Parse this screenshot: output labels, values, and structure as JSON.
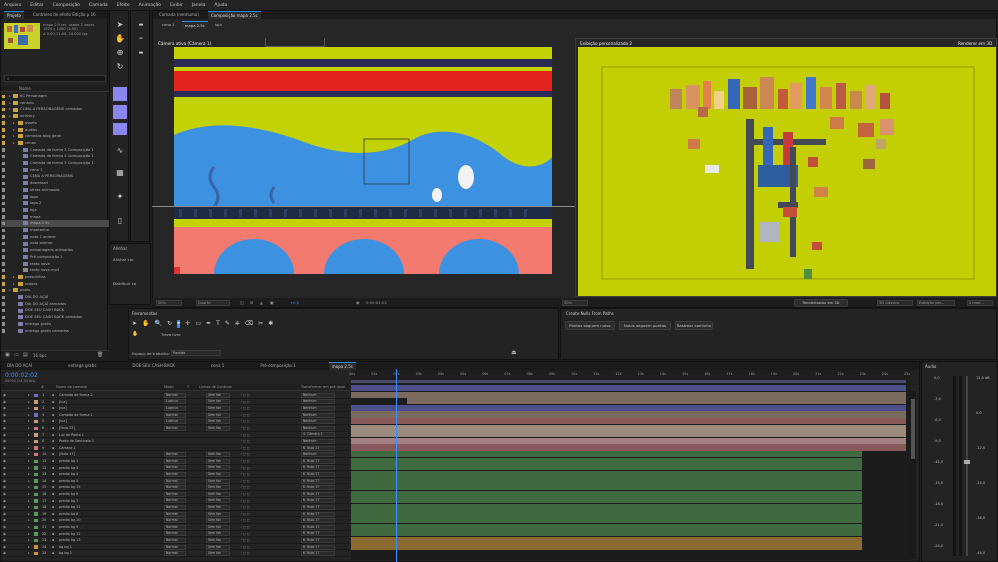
{
  "menu": [
    "Arquivo",
    "Editar",
    "Composição",
    "Camada",
    "Efeito",
    "Animação",
    "Exibir",
    "Janela",
    "Ajuda"
  ],
  "project": {
    "tabs": [
      "Projeto",
      "Controles de efeito Edição p 16"
    ],
    "info": [
      "mapa 2.5.ter, usado 2 vezes",
      "1920 x 1080 (1,00)",
      "Δ 0;00;11;00, 24,000 fps"
    ],
    "column_name": "Nome",
    "rows": [
      {
        "depth": 0,
        "name": "BC Personagm",
        "color": "#c9a43a",
        "icon": "folder"
      },
      {
        "depth": 0,
        "name": "cenario",
        "color": "#c9a43a",
        "icon": "folder"
      },
      {
        "depth": 0,
        "name": "CLIMA A PERSONAGENS camadas",
        "color": "#c9a43a",
        "icon": "folder"
      },
      {
        "depth": 0,
        "name": "delivery",
        "color": "#c9a43a",
        "icon": "folder"
      },
      {
        "depth": 1,
        "name": "assets",
        "color": "#c9a43a",
        "icon": "folder"
      },
      {
        "depth": 1,
        "name": "audios",
        "color": "#c9a43a",
        "icon": "folder"
      },
      {
        "depth": 1,
        "name": "camadas blog geral",
        "color": "#c9a43a",
        "icon": "folder"
      },
      {
        "depth": 1,
        "name": "cenas",
        "color": "#c9a43a",
        "icon": "folder"
      },
      {
        "depth": 2,
        "name": "Camada de forma 3 Composição 1",
        "color": "#8d8d8d",
        "icon": "comp"
      },
      {
        "depth": 2,
        "name": "Camada de forma 4 Composição 1",
        "color": "#8d8d8d",
        "icon": "comp"
      },
      {
        "depth": 2,
        "name": "Camada de forma 5 Composição 1",
        "color": "#8d8d8d",
        "icon": "comp"
      },
      {
        "depth": 2,
        "name": "cena 1",
        "color": "#8d8d8d",
        "icon": "comp"
      },
      {
        "depth": 2,
        "name": "CENA A PERSONAGENS",
        "color": "#8d8d8d",
        "icon": "comp"
      },
      {
        "depth": 2,
        "name": "download",
        "color": "#8d8d8d",
        "icon": "comp"
      },
      {
        "depth": 2,
        "name": "letras animadas",
        "color": "#8d8d8d",
        "icon": "comp"
      },
      {
        "depth": 2,
        "name": "logo",
        "color": "#8d8d8d",
        "icon": "comp"
      },
      {
        "depth": 2,
        "name": "logo 2",
        "color": "#8d8d8d",
        "icon": "comp"
      },
      {
        "depth": 2,
        "name": "loja",
        "color": "#8d8d8d",
        "icon": "comp"
      },
      {
        "depth": 2,
        "name": "mapa",
        "color": "#8d8d8d",
        "icon": "comp"
      },
      {
        "depth": 2,
        "name": "mapa 2.5c",
        "color": "#8d8d8d",
        "icon": "comp",
        "selected": true
      },
      {
        "depth": 2,
        "name": "montanha",
        "color": "#8d8d8d",
        "icon": "comp"
      },
      {
        "depth": 2,
        "name": "nota 1 animar",
        "color": "#8d8d8d",
        "icon": "comp"
      },
      {
        "depth": 2,
        "name": "nota animar",
        "color": "#8d8d8d",
        "icon": "comp"
      },
      {
        "depth": 2,
        "name": "personagens animados",
        "color": "#8d8d8d",
        "icon": "comp"
      },
      {
        "depth": 2,
        "name": "Pré-composição 1",
        "color": "#8d8d8d",
        "icon": "comp"
      },
      {
        "depth": 2,
        "name": "texto nove",
        "color": "#8d8d8d",
        "icon": "comp"
      },
      {
        "depth": 2,
        "name": "texto nove.mp4",
        "color": "#8d8d8d",
        "icon": "file"
      },
      {
        "depth": 1,
        "name": "pessoinhas",
        "color": "#c9a43a",
        "icon": "folder"
      },
      {
        "depth": 1,
        "name": "rodoes",
        "color": "#c9a43a",
        "icon": "folder"
      },
      {
        "depth": 0,
        "name": "posts",
        "color": "#c9a43a",
        "icon": "folder"
      },
      {
        "depth": 1,
        "name": "DIA DO AÇAÍ",
        "color": "#8d8d8d",
        "icon": "comp"
      },
      {
        "depth": 1,
        "name": "DIA DO AÇAÍ camadas",
        "color": "#8d8d8d",
        "icon": "comp"
      },
      {
        "depth": 1,
        "name": "DOE SEU CASH BACK",
        "color": "#8d8d8d",
        "icon": "comp"
      },
      {
        "depth": 1,
        "name": "DOE SEU CASH BACK camadas",
        "color": "#8d8d8d",
        "icon": "comp"
      },
      {
        "depth": 1,
        "name": "entrega gratis",
        "color": "#8d8d8d",
        "icon": "comp"
      },
      {
        "depth": 1,
        "name": "entrega gratis camadas",
        "color": "#8d8d8d",
        "icon": "comp"
      }
    ],
    "footer_bpc": "16 bpc"
  },
  "viewer": {
    "tabs": [
      "Camada (nenhuma)",
      "Composição mapa 2.5c"
    ],
    "subtabs": [
      "cena 1",
      "mapa 2.5c",
      "loja"
    ],
    "left_label": "Câmera ativa (Câmera 1)",
    "right_label": "Exibição personalizada 2",
    "renderer": "Renderer em 3D",
    "zoom": "50%",
    "quality": "Quarto",
    "timecode": "0:00:02:02",
    "offset": "+0,0",
    "right_zoom": "50%",
    "renderer_btn": "Renderizador em 3D",
    "view_3d": "3D clássico",
    "view_mode": "Exibição per...",
    "views": "2 mod..."
  },
  "tools_panel": {
    "title": "Ferramentas",
    "workspace_label": "Espaço de trabalho:",
    "workspace_value": "Padrão",
    "hand_label": "Trava livre"
  },
  "align_panel": {
    "title": "Alinhar",
    "align_label": "Alinhar cor",
    "distribute_label": "Distribuir ca"
  },
  "wiggle": {
    "title": "Create Nulls From Paths",
    "buttons": [
      "Pontos seguem nulos",
      "Nulos seguem pontos",
      "Rastrear caminho"
    ]
  },
  "timeline": {
    "tabs": [
      "DIA DO AÇAÍ",
      "entrega gratis",
      "DOE SEU CASH BACK",
      "cena 1",
      "Pré-composição 1",
      "mapa 2.5c"
    ],
    "timecode": "0:00:02:02",
    "frames": "00050 (24,00 fps)",
    "columns": [
      "#",
      "Nome da camada",
      "Modo",
      "T",
      "Linhas de Controle",
      "Pai e vincular",
      "Ir",
      "Transformar em pré-igual"
    ],
    "ruler": [
      "00s",
      "01s",
      "02s",
      "03s",
      "04s",
      "05s",
      "06s",
      "07s",
      "08s",
      "09s",
      "10s",
      "11s",
      "12s",
      "13s",
      "14s",
      "15s",
      "16s",
      "17s",
      "18s",
      "19s",
      "20s",
      "21s",
      "22s",
      "23s",
      "24s",
      "25s"
    ],
    "layers": [
      {
        "n": "1",
        "name": "Camada de forma 2",
        "mode": "Normal",
        "trk": "Sem fon",
        "parent": "Nenhum",
        "color": "#6f6fbf",
        "bar": "#4c4f8a",
        "bar_end": 1.0
      },
      {
        "n": "2",
        "name": "[luz]",
        "mode": "Luzinus",
        "trk": "Sem fon",
        "parent": "Nenhum",
        "color": "#c79e7a",
        "bar": "#7a6a5f",
        "bar_end": 1.0
      },
      {
        "n": "3",
        "name": "[luz]",
        "mode": "Luzinus",
        "trk": "Sem fon",
        "parent": "Nenhum",
        "color": "#c79e7a",
        "bar": "#7a6a5f",
        "bar_end": 1.0,
        "bar_start": 0.1
      },
      {
        "n": "4",
        "name": "Camada de forma 1",
        "mode": "Normal",
        "trk": "Sem fon",
        "parent": "Nenhum",
        "color": "#6f6fbf",
        "bar": "#4c4f8a",
        "bar_end": 1.0
      },
      {
        "n": "5",
        "name": "[luz]",
        "mode": "Luzinus",
        "trk": "Sem fon",
        "parent": "Nenhum",
        "color": "#c79e7a",
        "bar": "#7a6a5f",
        "bar_end": 1.0
      },
      {
        "n": "6",
        "name": "[Nulo 22]",
        "mode": "Normal",
        "trk": "Sem fon",
        "parent": "Nenhum",
        "color": "#c87c7c",
        "bar": "#8a5a5a",
        "bar_end": 1.0
      },
      {
        "n": "7",
        "name": "Luz de Ponto 1",
        "mode": "",
        "trk": "",
        "parent": "4. Câmera 1",
        "color": "#c79e7a",
        "bar": "#9b8a7e",
        "bar_end": 1.0
      },
      {
        "n": "8",
        "name": "Ponto de Sentinela 1",
        "mode": "",
        "trk": "",
        "parent": "Nenhum",
        "color": "#c79e7a",
        "bar": "#9b8a7e",
        "bar_end": 1.0
      },
      {
        "n": "9",
        "name": "Câmera 1",
        "mode": "",
        "trk": "",
        "parent": "6. Nulo 22",
        "color": "#c87c7c",
        "bar": "#a08080",
        "bar_end": 1.0
      },
      {
        "n": "10",
        "name": "[Nulo 17]",
        "mode": "Normal",
        "trk": "Sem fon",
        "parent": "Nenhum",
        "color": "#c87c7c",
        "bar": "#8a5a5a",
        "bar_end": 1.0
      },
      {
        "n": "11",
        "name": "predio bg 1",
        "mode": "Normal",
        "trk": "Sem fon",
        "parent": "6. Nulo 17",
        "color": "#5a9a5a",
        "bar": "#3f6a3f",
        "bar_end": 0.92
      },
      {
        "n": "12",
        "name": "predio bg 3",
        "mode": "Normal",
        "trk": "Sem fon",
        "parent": "6. Nulo 17",
        "color": "#5a9a5a",
        "bar": "#3f6a3f",
        "bar_end": 0.92
      },
      {
        "n": "13",
        "name": "predio bg 4",
        "mode": "Normal",
        "trk": "Sem fon",
        "parent": "6. Nulo 17",
        "color": "#5a9a5a",
        "bar": "#3f6a3f",
        "bar_end": 0.92
      },
      {
        "n": "14",
        "name": "predio bg 5",
        "mode": "Normal",
        "trk": "Sem fon",
        "parent": "6. Nulo 17",
        "color": "#5a9a5a",
        "bar": "#3f6a3f",
        "bar_end": 0.92
      },
      {
        "n": "15",
        "name": "predio bg 15",
        "mode": "Normal",
        "trk": "Sem fon",
        "parent": "6. Nulo 17",
        "color": "#5a9a5a",
        "bar": "#3f6a3f",
        "bar_end": 0.92
      },
      {
        "n": "16",
        "name": "predio bg 6",
        "mode": "Normal",
        "trk": "Sem fon",
        "parent": "6. Nulo 17",
        "color": "#5a9a5a",
        "bar": "#3f6a3f",
        "bar_end": 0.92
      },
      {
        "n": "17",
        "name": "predio bg 7",
        "mode": "Normal",
        "trk": "Sem fon",
        "parent": "6. Nulo 17",
        "color": "#5a9a5a",
        "bar": "#3f6a3f",
        "bar_end": 0.92
      },
      {
        "n": "18",
        "name": "predio bg 11",
        "mode": "Normal",
        "trk": "Sem fon",
        "parent": "6. Nulo 17",
        "color": "#5a9a5a",
        "bar": "#3f6a3f",
        "bar_end": 0.92
      },
      {
        "n": "19",
        "name": "predio bg 8",
        "mode": "Normal",
        "trk": "Sem fon",
        "parent": "6. Nulo 17",
        "color": "#5a9a5a",
        "bar": "#3f6a3f",
        "bar_end": 0.92
      },
      {
        "n": "20",
        "name": "predio bg 10",
        "mode": "Normal",
        "trk": "Sem fon",
        "parent": "6. Nulo 17",
        "color": "#5a9a5a",
        "bar": "#3f6a3f",
        "bar_end": 0.92
      },
      {
        "n": "21",
        "name": "predio bg 9",
        "mode": "Normal",
        "trk": "Sem fon",
        "parent": "6. Nulo 17",
        "color": "#5a9a5a",
        "bar": "#3f6a3f",
        "bar_end": 0.92
      },
      {
        "n": "22",
        "name": "predio bg 12",
        "mode": "Normal",
        "trk": "Sem fon",
        "parent": "6. Nulo 17",
        "color": "#5a9a5a",
        "bar": "#3f6a3f",
        "bar_end": 0.92
      },
      {
        "n": "23",
        "name": "predio bg 13",
        "mode": "Normal",
        "trk": "Sem fon",
        "parent": "6. Nulo 17",
        "color": "#5a9a5a",
        "bar": "#3f6a3f",
        "bar_end": 0.92
      },
      {
        "n": "24",
        "name": "bg bg 1",
        "mode": "Normal",
        "trk": "Sem fon",
        "parent": "6. Nulo 17",
        "color": "#c8963c",
        "bar": "#8a6a2f",
        "bar_end": 0.92
      },
      {
        "n": "25",
        "name": "bg bg 2",
        "mode": "Normal",
        "trk": "Sem fon",
        "parent": "6. Nulo 17",
        "color": "#c8963c",
        "bar": "#8a6a2f",
        "bar_end": 0.92
      }
    ]
  },
  "audio": {
    "title": "Áudio",
    "left_scale": [
      "0,0",
      "-3,0",
      "-6,0",
      "-9,0",
      "-12,0",
      "-15,0",
      "-18,0",
      "-21,0",
      "-24,0"
    ],
    "right_scale": [
      "12,0 dB",
      "0,0",
      "-12,0",
      "-24,0",
      "-36,0",
      "-48,0"
    ]
  }
}
